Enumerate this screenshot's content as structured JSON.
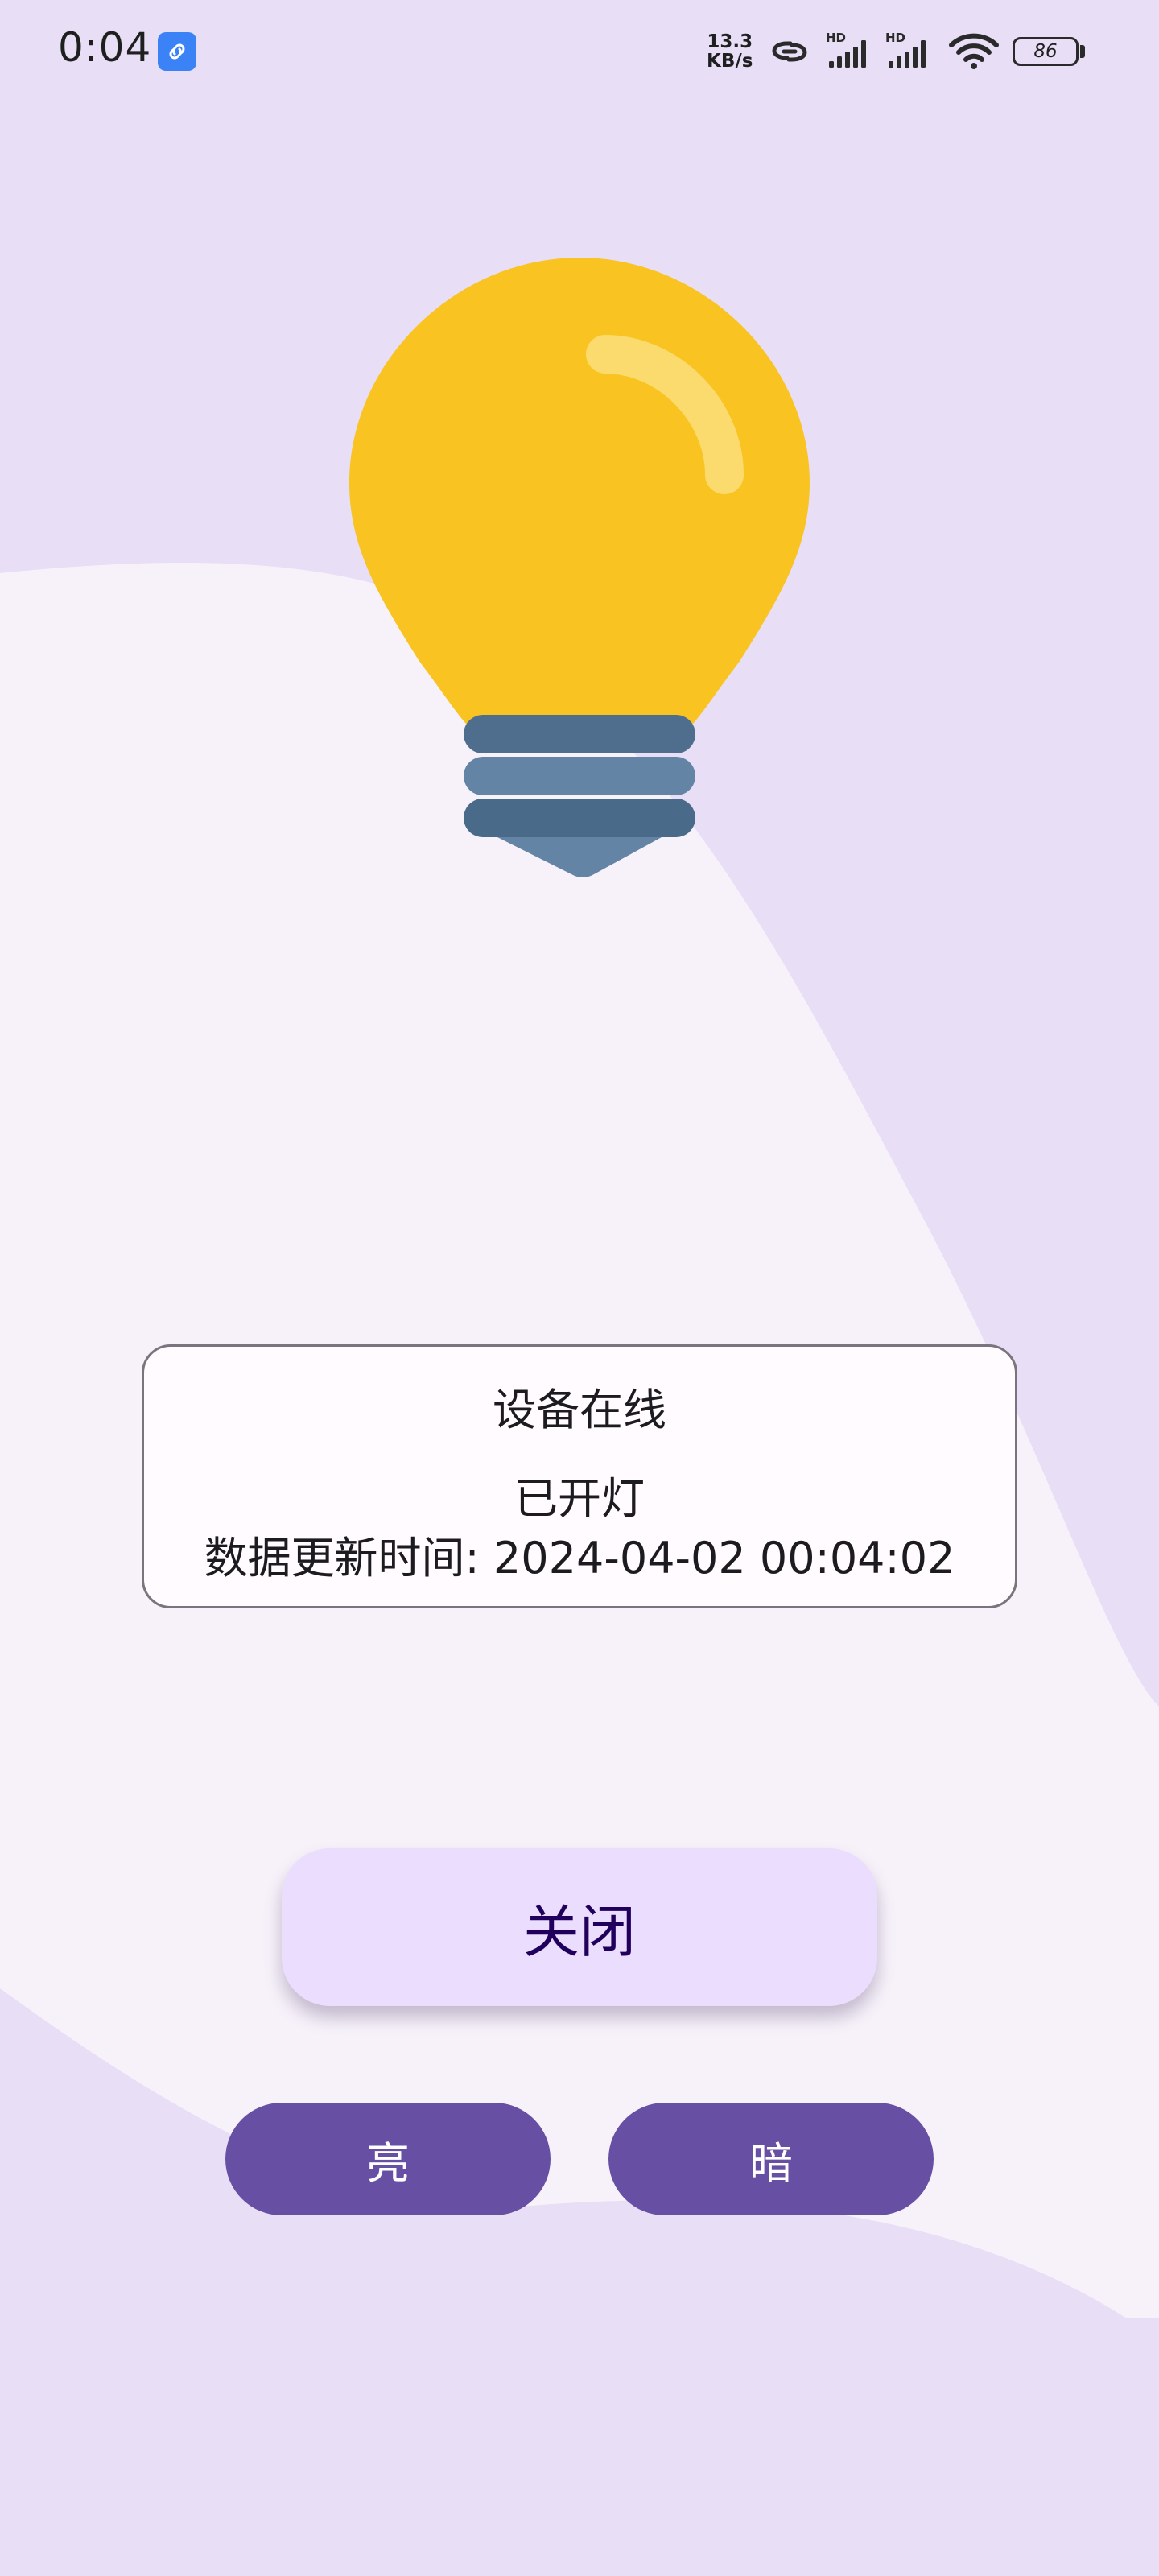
{
  "status_bar": {
    "time": "0:04",
    "net_speed_value": "13.3",
    "net_speed_unit": "KB/s",
    "battery": "86",
    "icons": [
      "link-app-icon",
      "hotspot-link-icon",
      "hd-signal-icon",
      "hd-signal-icon",
      "wifi-icon",
      "battery-icon"
    ]
  },
  "bulb": {
    "icon": "lightbulb-icon",
    "colors": {
      "glass": "#F9C322",
      "highlight": "#FBDA6E",
      "base_dark": "#4A6A8A",
      "base_light": "#6384A4"
    }
  },
  "status_card": {
    "online_text": "设备在线",
    "light_state": "已开灯",
    "update_time": "数据更新时间: 2024-04-02 00:04:02"
  },
  "controls": {
    "close_label": "关闭",
    "bright_label": "亮",
    "dim_label": "暗"
  },
  "colors": {
    "background": "#E8DEF6",
    "wave": "#F7F2FA",
    "primary": "#6750A4",
    "tonal_button": "#EBDDFD"
  }
}
